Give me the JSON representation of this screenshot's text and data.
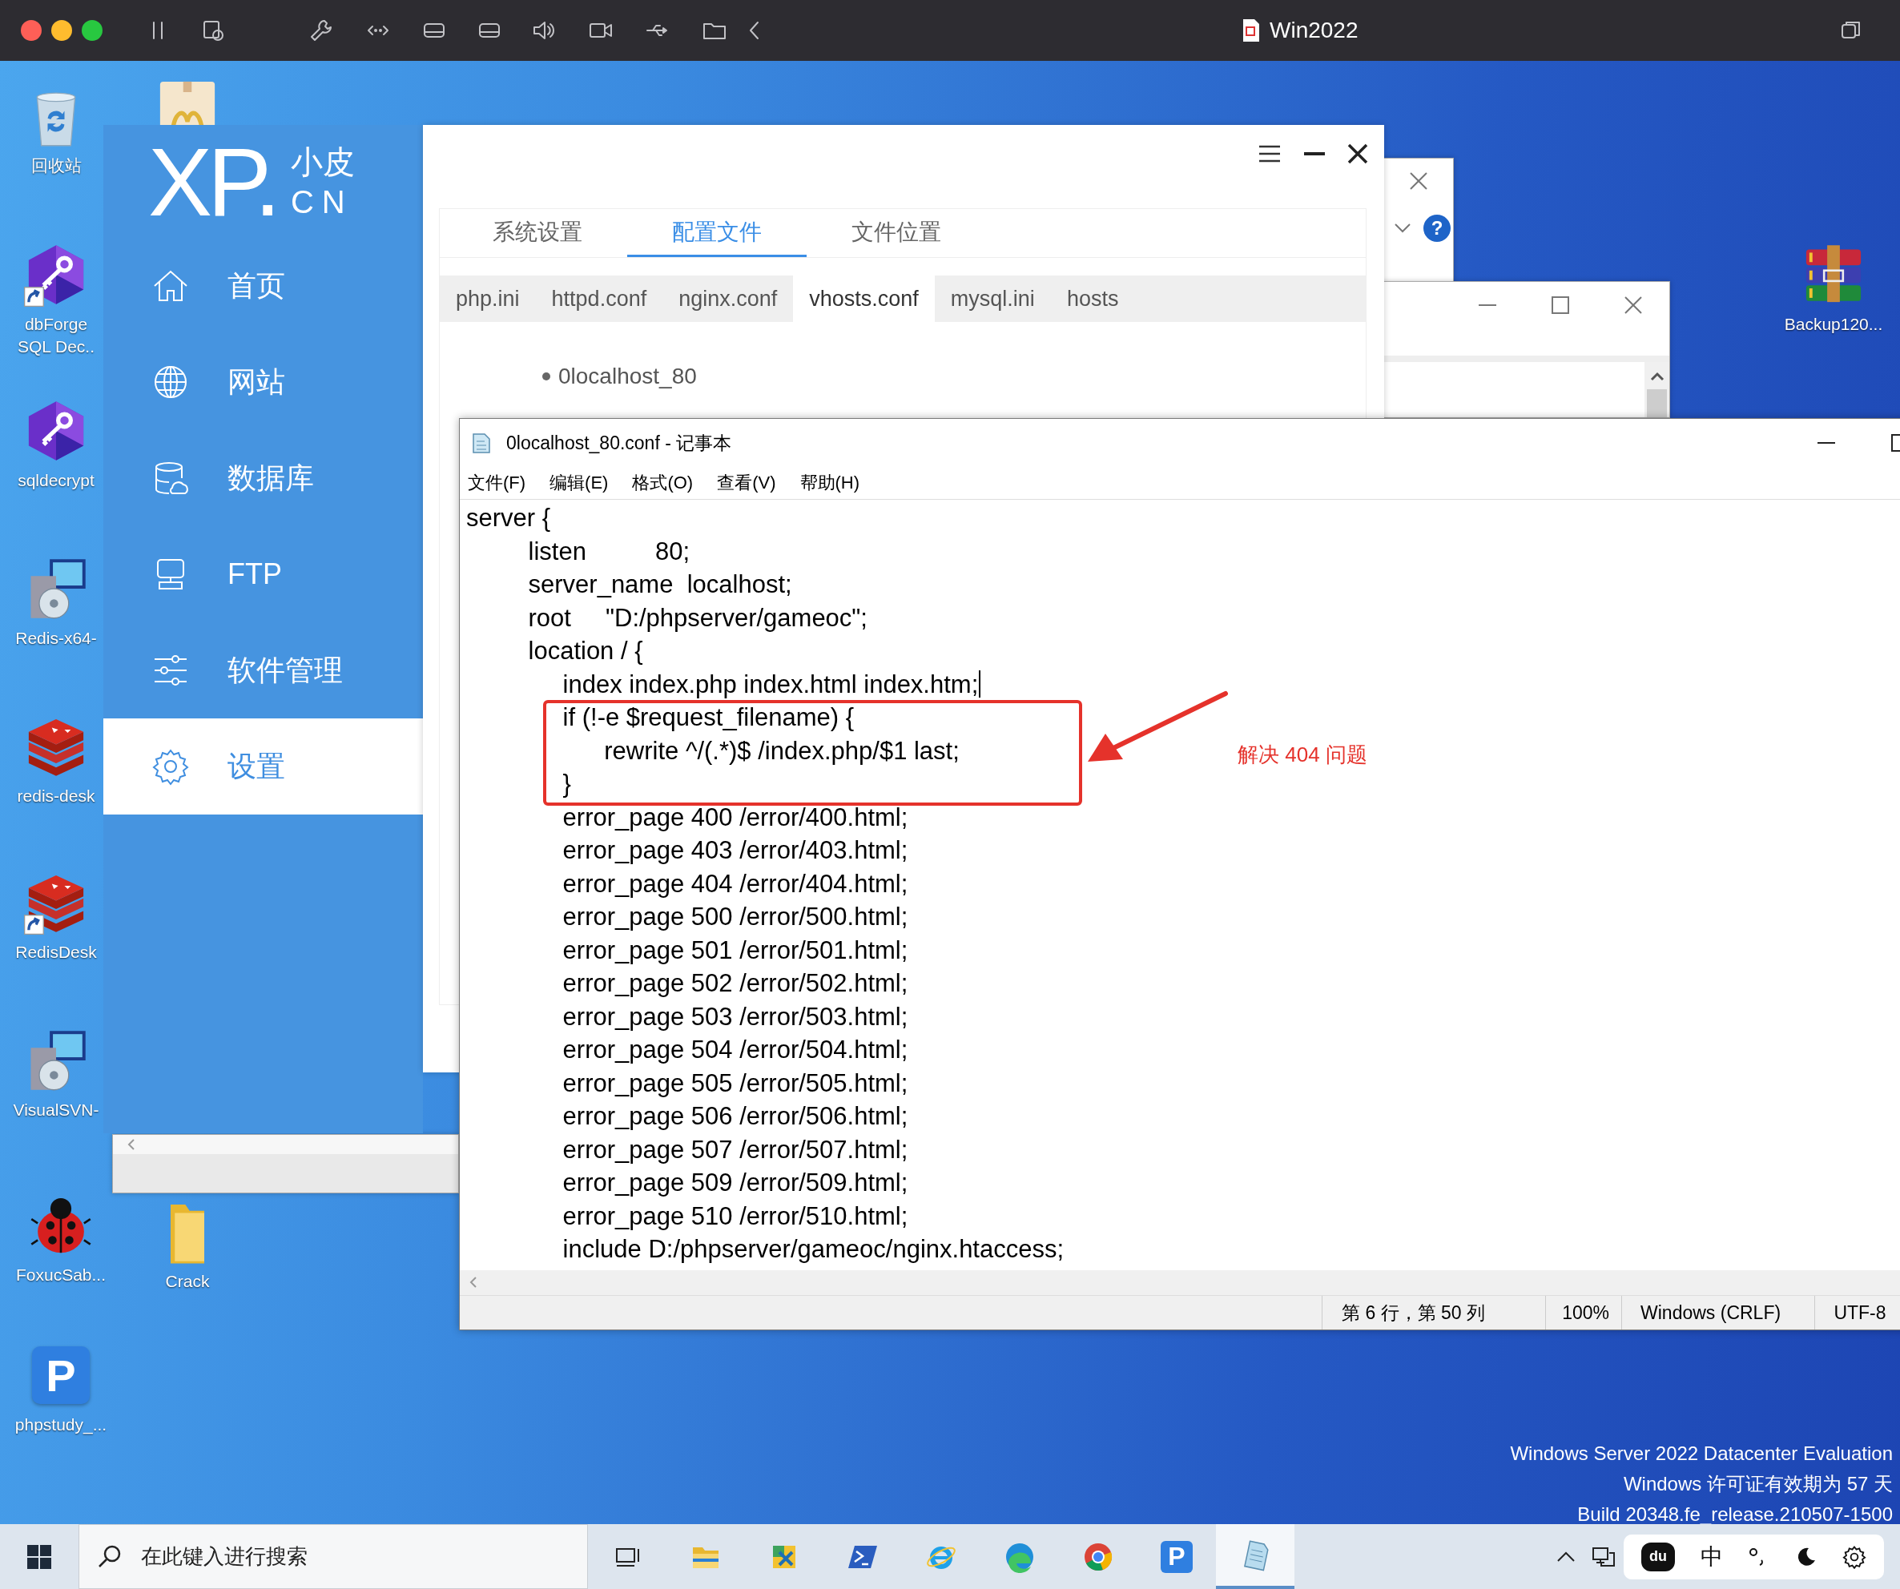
{
  "host_bar": {
    "title": "Win2022"
  },
  "desktop_icons": [
    {
      "kind": "recycle-bin",
      "label": "回收站",
      "shortcut": false
    },
    {
      "kind": "package",
      "shortcut": false
    },
    {
      "kind": "key-cube",
      "label": "dbForge SQL Dec..",
      "shortcut": true
    },
    {
      "kind": "key-cube",
      "label": "sqldecrypt",
      "shortcut": false
    },
    {
      "kind": "installer",
      "label": "Redis-x64-",
      "shortcut": false
    },
    {
      "kind": "redis",
      "label": "redis-desk",
      "shortcut": false
    },
    {
      "kind": "redis",
      "label": "RedisDesk",
      "shortcut": true
    },
    {
      "kind": "installer",
      "label": "VisualSVN-",
      "shortcut": false
    },
    {
      "kind": "ladybug",
      "label": "FoxucSab...",
      "shortcut": false
    },
    {
      "kind": "folder",
      "label": "Crack",
      "shortcut": false
    },
    {
      "kind": "phpstudy",
      "glyph": "P",
      "label": "phpstudy_...",
      "shortcut": false
    },
    {
      "kind": "archive",
      "label": "Backup120...",
      "shortcut": false
    }
  ],
  "dialog": {
    "help_glyph": "?"
  },
  "xp_app": {
    "logo": {
      "mark": "XP.",
      "name": "小皮",
      "domain": "CN"
    },
    "nav": [
      {
        "kind": "home",
        "label": "首页",
        "selected": false
      },
      {
        "kind": "globe",
        "label": "网站",
        "selected": false
      },
      {
        "kind": "database",
        "label": "数据库",
        "selected": false
      },
      {
        "kind": "monitor",
        "label": "FTP",
        "selected": false
      },
      {
        "kind": "sliders",
        "label": "软件管理",
        "selected": false
      },
      {
        "kind": "gear",
        "label": "设置",
        "selected": true
      }
    ],
    "tabs": [
      {
        "label": "系统设置",
        "selected": false
      },
      {
        "label": "配置文件",
        "selected": true
      },
      {
        "label": "文件位置",
        "selected": false
      }
    ],
    "subtabs": [
      {
        "label": "php.ini",
        "selected": false
      },
      {
        "label": "httpd.conf",
        "selected": false
      },
      {
        "label": "nginx.conf",
        "selected": false
      },
      {
        "label": "vhosts.conf",
        "selected": true
      },
      {
        "label": "mysql.ini",
        "selected": false
      },
      {
        "label": "hosts",
        "selected": false
      }
    ],
    "sites": [
      "0localhost_80"
    ]
  },
  "notepad": {
    "title": "0localhost_80.conf - 记事本",
    "menu": [
      "文件(F)",
      "编辑(E)",
      "格式(O)",
      "查看(V)",
      "帮助(H)"
    ],
    "lines": [
      {
        "text": "server {",
        "caret": false
      },
      {
        "text": "         listen          80;",
        "caret": false
      },
      {
        "text": "         server_name  localhost;",
        "caret": false
      },
      {
        "text": "         root     \"D:/phpserver/gameoc\";",
        "caret": false
      },
      {
        "text": "         location / {",
        "caret": false
      },
      {
        "text": "              index index.php index.html index.htm;",
        "caret": true
      },
      {
        "text": "              if (!-e $request_filename) {",
        "caret": false
      },
      {
        "text": "                    rewrite ^/(.*)$ /index.php/$1 last;",
        "caret": false
      },
      {
        "text": "              }",
        "caret": false
      },
      {
        "text": "              error_page 400 /error/400.html;",
        "caret": false
      },
      {
        "text": "              error_page 403 /error/403.html;",
        "caret": false
      },
      {
        "text": "              error_page 404 /error/404.html;",
        "caret": false
      },
      {
        "text": "              error_page 500 /error/500.html;",
        "caret": false
      },
      {
        "text": "              error_page 501 /error/501.html;",
        "caret": false
      },
      {
        "text": "              error_page 502 /error/502.html;",
        "caret": false
      },
      {
        "text": "              error_page 503 /error/503.html;",
        "caret": false
      },
      {
        "text": "              error_page 504 /error/504.html;",
        "caret": false
      },
      {
        "text": "              error_page 505 /error/505.html;",
        "caret": false
      },
      {
        "text": "              error_page 506 /error/506.html;",
        "caret": false
      },
      {
        "text": "              error_page 507 /error/507.html;",
        "caret": false
      },
      {
        "text": "              error_page 509 /error/509.html;",
        "caret": false
      },
      {
        "text": "              error_page 510 /error/510.html;",
        "caret": false
      },
      {
        "text": "              include D:/phpserver/gameoc/nginx.htaccess;",
        "caret": false
      }
    ],
    "status": [
      "第 6 行，第 50 列",
      "100%",
      "Windows (CRLF)",
      "UTF-8"
    ]
  },
  "annotation": {
    "note": "解决 404 问题"
  },
  "system_info": [
    "Windows Server 2022 Datacenter Evaluation",
    "Windows 许可证有效期为 57 天",
    "Build 20348.fe_release.210507-1500"
  ],
  "taskbar": {
    "search": {
      "placeholder": "在此键入进行搜索"
    },
    "apps": [
      {
        "kind": "task-view",
        "selected": false
      },
      {
        "kind": "file-explorer",
        "selected": false
      },
      {
        "kind": "tool",
        "selected": false
      },
      {
        "kind": "terminal",
        "selected": false
      },
      {
        "kind": "ie",
        "selected": false
      },
      {
        "kind": "edge",
        "selected": false
      },
      {
        "kind": "chrome",
        "selected": false
      },
      {
        "kind": "phpstudy",
        "glyph": "P",
        "selected": false
      },
      {
        "kind": "notepad",
        "selected": true
      }
    ],
    "ime": {
      "glyph": "du",
      "mode": "中"
    }
  }
}
